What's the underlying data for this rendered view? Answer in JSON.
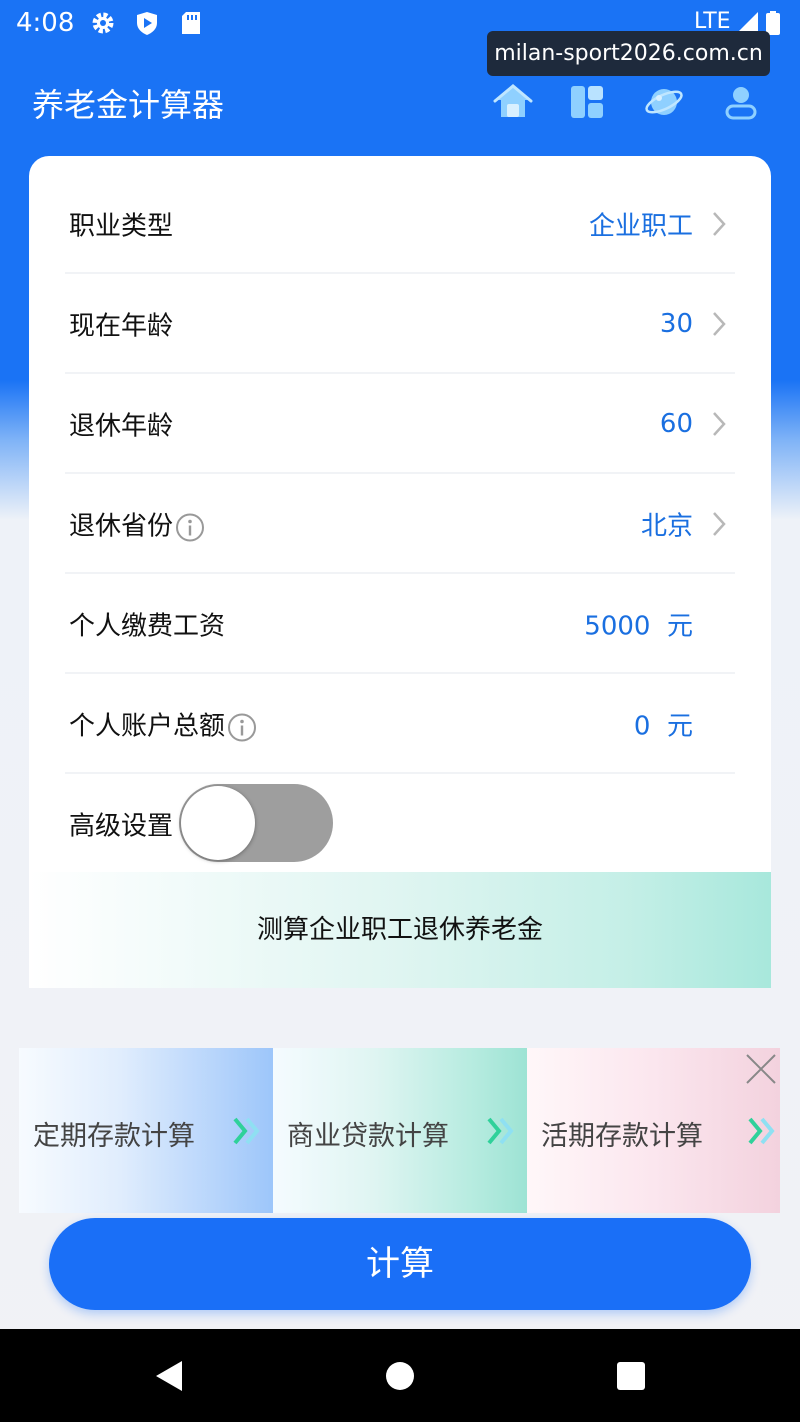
{
  "status_bar": {
    "time": "4:08",
    "network": "LTE",
    "icons": [
      "gear-icon",
      "shield-play-icon",
      "sd-card-icon",
      "signal-icon",
      "battery-icon"
    ]
  },
  "watermark": "milan-sport2026.com.cn",
  "header": {
    "title": "养老金计算器",
    "icons": [
      "home-icon",
      "dashboard-icon",
      "planet-icon",
      "user-icon"
    ]
  },
  "form": {
    "rows": [
      {
        "label": "职业类型",
        "value": "企业职工"
      },
      {
        "label": "现在年龄",
        "value": "30"
      },
      {
        "label": "退休年龄",
        "value": "60"
      },
      {
        "label": "退休省份",
        "value": "北京"
      },
      {
        "label": "个人缴费工资",
        "value": "5000  元"
      },
      {
        "label": "个人账户总额",
        "value": "0  元"
      }
    ],
    "advanced_label": "高级设置",
    "advanced_enabled": false
  },
  "banner": "测算企业职工退休养老金",
  "ad": {
    "items": [
      "定期存款计算",
      "商业贷款计算",
      "活期存款计算"
    ]
  },
  "calculate_button": "计算",
  "colors": {
    "primary": "#1a6ff7",
    "value_text": "#1a6fe0",
    "arrow_green": "#2fd19a"
  }
}
